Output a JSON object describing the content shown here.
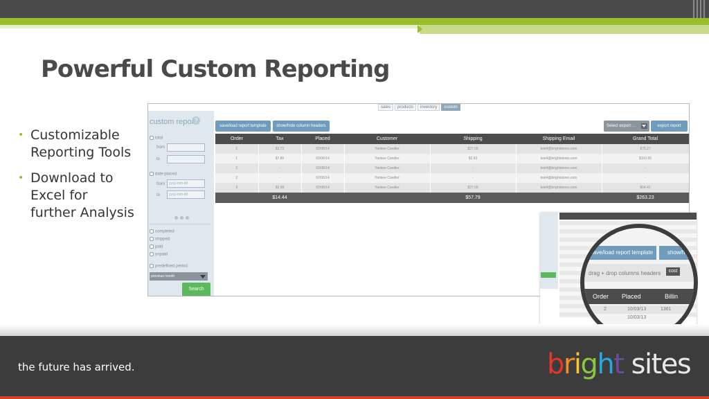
{
  "slide": {
    "title": "Powerful Custom Reporting",
    "bullets": [
      "Customizable Reporting Tools",
      "Download to Excel for further Analysis"
    ],
    "tagline": "the future has arrived.",
    "logo": {
      "part1": "bright",
      "part2": "sites"
    }
  },
  "colors": {
    "accent": "#9bbd2c",
    "footer": "#3c3c3c",
    "button_blue": "#6f9cbc",
    "search_green": "#5cb85c"
  },
  "report": {
    "tabs": [
      "sales",
      "products",
      "inventory",
      "custom"
    ],
    "active_tab": "custom",
    "panel_title": "custom report",
    "help_icon": "?",
    "filters": {
      "total": "total",
      "from": "from",
      "to": "to",
      "date_placed": "date placed",
      "date_placeholder": "yyyy-mm-dd",
      "statuses": [
        "completed",
        "shipped",
        "paid",
        "unpaid"
      ],
      "predefined_period": "predefined period",
      "period_value": "previous month",
      "search": "Search"
    },
    "buttons": {
      "save_load": "save/load report template",
      "show_hide": "show/hide column headers",
      "select_export": "Select export ...",
      "export_report": "export report"
    },
    "columns": [
      "Order",
      "Tax",
      "Placed",
      "Customer",
      "Shipping",
      "Shipping Email",
      "Grand Total"
    ],
    "rows": [
      [
        "1",
        "$3.72",
        "02/06/14",
        "Yankee Candler",
        "$27.55",
        "test4@brightstores.com",
        "$75.27"
      ],
      [
        "1",
        "$7.86",
        "02/06/14",
        "Yankee Candler",
        "$2.69",
        "test4@brightstores.com",
        "$103.55"
      ],
      [
        "2",
        "-",
        "02/06/14",
        "Yankee Candler",
        "-",
        "test4@brightstores.com",
        "-"
      ],
      [
        "2",
        "-",
        "02/06/14",
        "Yankee Candler",
        "-",
        "test4@brightstores.com",
        "-"
      ],
      [
        "3",
        "$2.98",
        "02/06/14",
        "Yankee Candler",
        "$27.55",
        "test4@brightstores.com",
        "$64.41"
      ]
    ],
    "totals": {
      "tax": "$14.44",
      "shipping": "$57.79",
      "grand_total": "$263.23"
    }
  },
  "zoom": {
    "save_load": "save/load report template",
    "show_hide": "show/hide",
    "drag_drop": "drag + drop columns headers",
    "cost": "cost",
    "headers": [
      "Order",
      "Placed",
      "Billin"
    ],
    "rows": [
      [
        "2",
        "10/03/13",
        "1361"
      ],
      [
        "",
        "10/03/13",
        ""
      ]
    ]
  }
}
